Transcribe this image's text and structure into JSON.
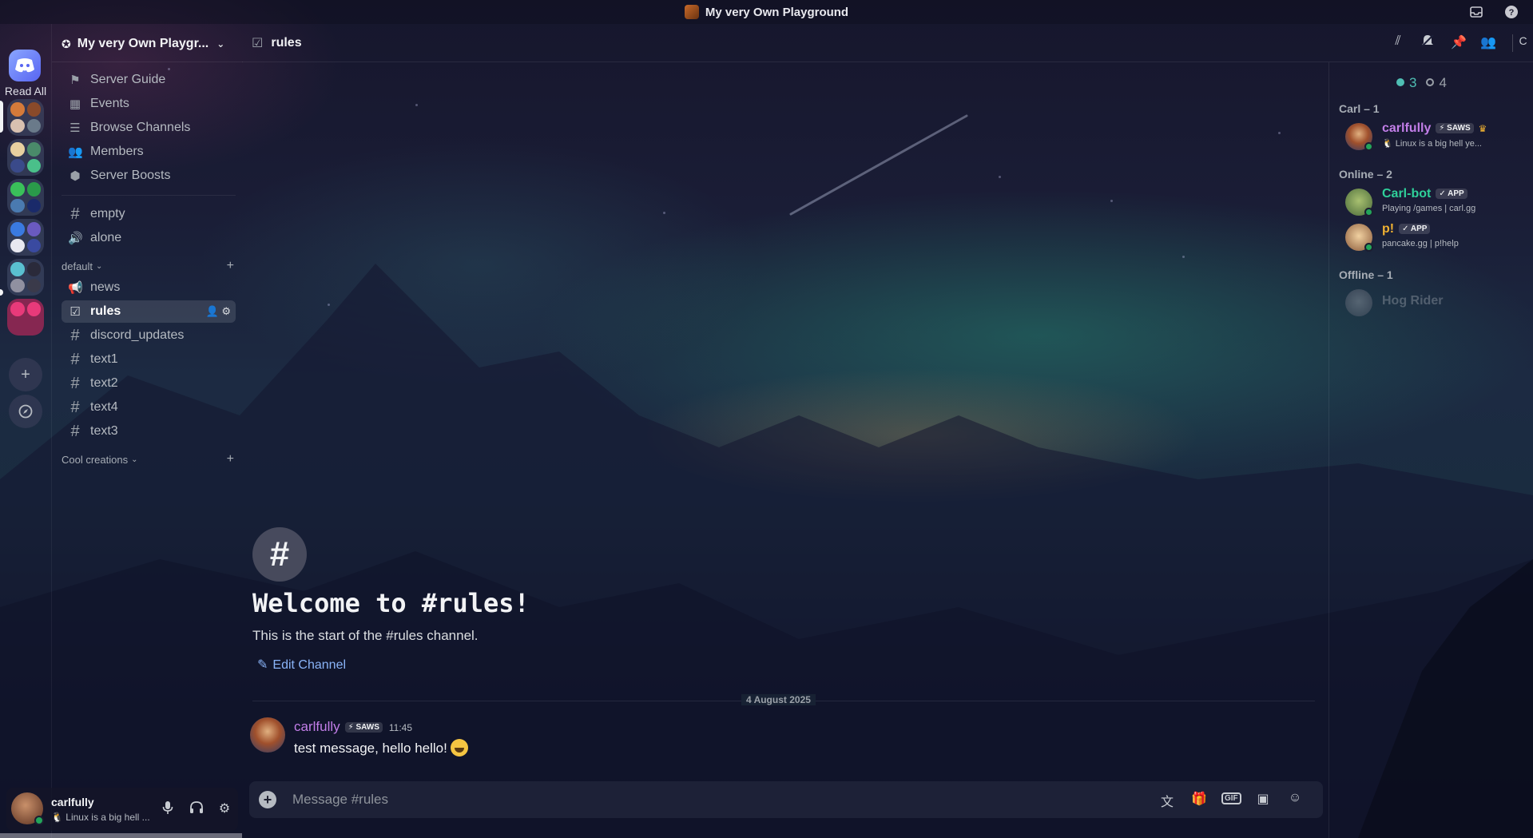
{
  "window": {
    "title": "My very Own Playground"
  },
  "rail": {
    "home_label": "Read All"
  },
  "sidebar": {
    "server_name": "My very Own Playgr...",
    "nav": [
      {
        "label": "Server Guide",
        "icon": "signpost-icon"
      },
      {
        "label": "Events",
        "icon": "calendar-icon"
      },
      {
        "label": "Browse Channels",
        "icon": "browse-channels-icon"
      },
      {
        "label": "Members",
        "icon": "members-icon"
      },
      {
        "label": "Server Boosts",
        "icon": "boost-icon"
      }
    ],
    "top_channels": [
      {
        "label": "empty",
        "icon": "hash-icon"
      },
      {
        "label": "alone",
        "icon": "speaker-icon"
      }
    ],
    "categories": [
      {
        "label": "default"
      },
      {
        "label": "Cool creations"
      }
    ],
    "default_channels": [
      {
        "label": "news",
        "icon": "megaphone-icon"
      },
      {
        "label": "rules",
        "icon": "rules-icon",
        "active": true
      },
      {
        "label": "discord_updates",
        "icon": "hash-icon"
      },
      {
        "label": "text1",
        "icon": "hash-icon"
      },
      {
        "label": "text2",
        "icon": "hash-icon"
      },
      {
        "label": "text4",
        "icon": "hash-icon"
      },
      {
        "label": "text3",
        "icon": "hash-icon"
      }
    ]
  },
  "user_panel": {
    "name": "carlfully",
    "status": "Linux is a big hell ..."
  },
  "channel": {
    "name": "rules"
  },
  "welcome": {
    "title": "Welcome to #rules!",
    "subtitle": "This is the start of the #rules channel.",
    "edit_label": "Edit Channel"
  },
  "messages": {
    "date_divider": "4 August 2025",
    "items": [
      {
        "author": "carlfully",
        "badge": "SAWS",
        "time": "11:45",
        "text": "test message, hello hello!",
        "emoji": "smiley-emoji"
      }
    ]
  },
  "composer": {
    "placeholder": "Message #rules"
  },
  "member_list": {
    "online_count": "3",
    "offline_count": "4",
    "groups": [
      {
        "label": "Carl – 1",
        "members": [
          {
            "name": "carlfully",
            "badge": "SAWS",
            "status": "Linux is a big hell ye...",
            "color": "#c27ee8",
            "owner": true
          }
        ]
      },
      {
        "label": "Online – 2",
        "members": [
          {
            "name": "Carl-bot",
            "badge": "APP",
            "status": "Playing /games | carl.gg",
            "color": "#2fd09a"
          },
          {
            "name": "p!",
            "badge": "APP",
            "status": "pancake.gg | p!help",
            "color": "#f0b232"
          }
        ]
      },
      {
        "label": "Offline – 1",
        "members": [
          {
            "name": "Hog Rider",
            "status": "",
            "color": "#b5bac1"
          }
        ]
      }
    ]
  },
  "colors": {
    "accent": "#5865f2",
    "online": "#23a55a",
    "author": "#c27ee8",
    "link": "#8ab4f8"
  }
}
